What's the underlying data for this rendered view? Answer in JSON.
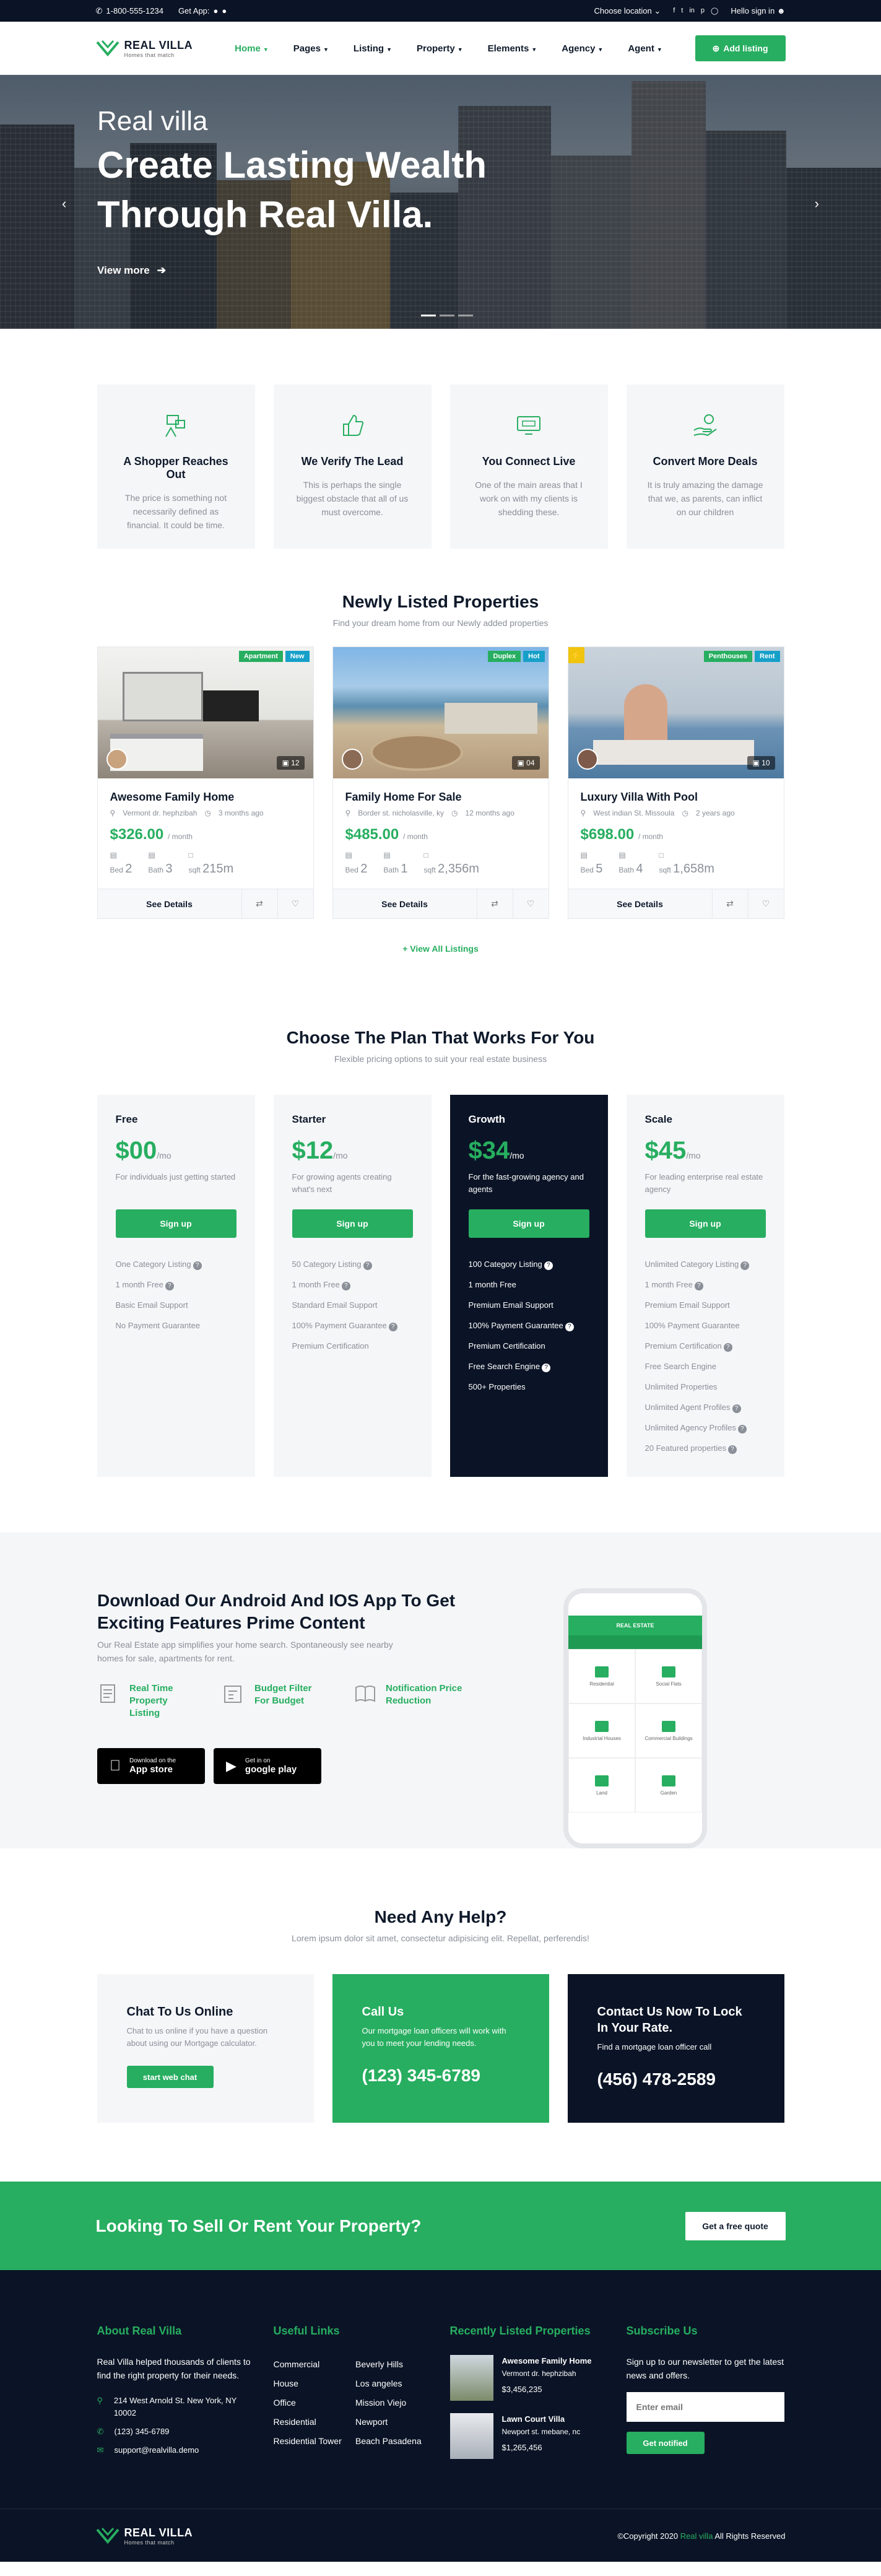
{
  "topbar": {
    "phone": "1-800-555-1234",
    "get_app": "Get App:",
    "location": "Choose location",
    "signin": "Hello sign in"
  },
  "header": {
    "logo_name": "REAL VILLA",
    "logo_tag": "Homes that match",
    "nav": [
      "Home",
      "Pages",
      "Listing",
      "Property",
      "Elements",
      "Agency",
      "Agent"
    ],
    "add_listing": "Add listing"
  },
  "hero": {
    "small": "Real villa",
    "title": "Create Lasting Wealth Through Real Villa.",
    "cta": "View more"
  },
  "features": [
    {
      "icon": "shopper-icon",
      "title": "A Shopper Reaches Out",
      "text": "The price is something not necessarily defined as financial. It could be time."
    },
    {
      "icon": "thumbs-up-icon",
      "title": "We Verify The Lead",
      "text": "This is perhaps the single biggest obstacle that all of us must overcome."
    },
    {
      "icon": "computer-icon",
      "title": "You Connect Live",
      "text": "One of the main areas that I work on with my clients is shedding these."
    },
    {
      "icon": "hand-money-icon",
      "title": "Convert More Deals",
      "text": "It is truly amazing the damage that we, as parents, can inflict on our children"
    }
  ],
  "listings": {
    "title": "Newly Listed Properties",
    "subtitle": "Find your dream home from our Newly added properties",
    "view_all": "View All Listings",
    "items": [
      {
        "badges": [
          "Apartment",
          "New"
        ],
        "featured": false,
        "photos": "12",
        "name": "Awesome Family Home",
        "address": "Vermont dr. hephzibah",
        "time": "3 months ago",
        "price": "$326.00",
        "per": "/ month",
        "bed_label": "Bed",
        "bed": "2",
        "bath_label": "Bath",
        "bath": "3",
        "sqft_label": "sqft",
        "sqft": "215m",
        "see": "See Details"
      },
      {
        "badges": [
          "Duplex",
          "Hot"
        ],
        "featured": false,
        "photos": "04",
        "name": "Family Home For Sale",
        "address": "Border st. nicholasville, ky",
        "time": "12 months ago",
        "price": "$485.00",
        "per": "/ month",
        "bed_label": "Bed",
        "bed": "2",
        "bath_label": "Bath",
        "bath": "1",
        "sqft_label": "sqft",
        "sqft": "2,356m",
        "see": "See Details"
      },
      {
        "badges": [
          "Penthouses",
          "Rent"
        ],
        "featured": true,
        "photos": "10",
        "name": "Luxury Villa With Pool",
        "address": "West indian St. Missoula",
        "time": "2 years ago",
        "price": "$698.00",
        "per": "/ month",
        "bed_label": "Bed",
        "bed": "5",
        "bath_label": "Bath",
        "bath": "4",
        "sqft_label": "sqft",
        "sqft": "1,658m",
        "see": "See Details"
      }
    ]
  },
  "pricing": {
    "title": "Choose The Plan That Works For You",
    "subtitle": "Flexible pricing options to suit your real estate business",
    "plans": [
      {
        "name": "Free",
        "price": "$00",
        "per": "/mo",
        "desc": "For individuals just getting started",
        "cta": "Sign up",
        "features": [
          "One Category Listing",
          "1 month Free",
          "Basic Email Support",
          "No Payment Guarantee"
        ]
      },
      {
        "name": "Starter",
        "price": "$12",
        "per": "/mo",
        "desc": "For growing agents creating what's next",
        "cta": "Sign up",
        "features": [
          "50 Category Listing",
          "1 month Free",
          "Standard Email Support",
          "100% Payment Guarantee",
          "Premium Certification"
        ]
      },
      {
        "name": "Growth",
        "price": "$34",
        "per": "/mo",
        "desc": "For the fast-growing agency and agents",
        "cta": "Sign up",
        "features": [
          "100 Category Listing",
          "1 month Free",
          "Premium Email Support",
          "100% Payment Guarantee",
          "Premium Certification",
          "Free Search Engine",
          "500+ Properties"
        ]
      },
      {
        "name": "Scale",
        "price": "$45",
        "per": "/mo",
        "desc": "For leading enterprise real estate agency",
        "cta": "Sign up",
        "features": [
          "Unlimited Category Listing",
          "1 month Free",
          "Premium Email Support",
          "100% Payment Guarantee",
          "Premium Certification",
          "Free Search Engine",
          "Unlimited Properties",
          "Unlimited Agent Profiles",
          "Unlimited Agency Profiles",
          "20 Featured properties"
        ]
      }
    ]
  },
  "app": {
    "title": "Download Our Android And IOS App To Get Exciting Features Prime Content",
    "subtitle": "Our Real Estate app simplifies your home search. Spontaneously see nearby homes for sale, apartments for rent.",
    "features": [
      "Real Time Property Listing",
      "Budget Filter For Budget",
      "Notification Price Reduction"
    ],
    "appstore_small": "Download on the",
    "appstore_large": "App store",
    "play_small": "Get in on",
    "play_large": "google play",
    "phone_brand": "REAL ESTATE",
    "phone_cells": [
      "Residential",
      "Social Flats",
      "Industrial Houses",
      "Commercial Buildings",
      "Land",
      "Garden"
    ]
  },
  "help": {
    "title": "Need Any Help?",
    "subtitle": "Lorem ipsum dolor sit amet, consectetur adipisicing elit. Repellat, perferendis!",
    "boxes": [
      {
        "title": "Chat To Us Online",
        "text": "Chat to us online if you have a question about using our Mortgage calculator.",
        "cta": "start web chat"
      },
      {
        "title": "Call Us",
        "text": "Our mortgage loan officers will work with you to meet your lending needs.",
        "phone": "(123) 345-6789"
      },
      {
        "title": "Contact Us Now To Lock In Your Rate.",
        "text": "Find a mortgage loan officer call",
        "phone": "(456) 478-2589"
      }
    ]
  },
  "cta": {
    "title": "Looking To Sell Or Rent Your Property?",
    "button": "Get a free quote"
  },
  "footer": {
    "about_title": "About Real Villa",
    "about_text": "Real Villa helped thousands of clients to find the right property for their needs.",
    "address": "214 West Arnold St. New York, NY 10002",
    "phone": "(123) 345-6789",
    "email": "support@realvilla.demo",
    "links_title": "Useful Links",
    "links": [
      "Commercial",
      "Beverly Hills",
      "House",
      "Los angeles",
      "Office",
      "Mission Viejo",
      "Residential",
      "Newport",
      "Residential Tower",
      "Beach Pasadena"
    ],
    "recent_title": "Recently Listed Properties",
    "recent": [
      {
        "name": "Awesome Family Home",
        "address": "Vermont dr. hephzibah",
        "price": "$3,456,235"
      },
      {
        "name": "Lawn Court Villa",
        "address": "Newport st. mebane, nc",
        "price": "$1,265,456"
      }
    ],
    "subscribe_title": "Subscribe Us",
    "subscribe_text": "Sign up to our newsletter to get the latest news and offers.",
    "email_placeholder": "Enter email",
    "notify": "Get notified",
    "copyright_prefix": "©Copyright 2020 ",
    "copyright_brand": "Real villa",
    "copyright_suffix": " All Rights Reserved"
  },
  "colors": {
    "accent": "#27ae60",
    "dark": "#0b1426",
    "muted": "#8a8f98"
  }
}
